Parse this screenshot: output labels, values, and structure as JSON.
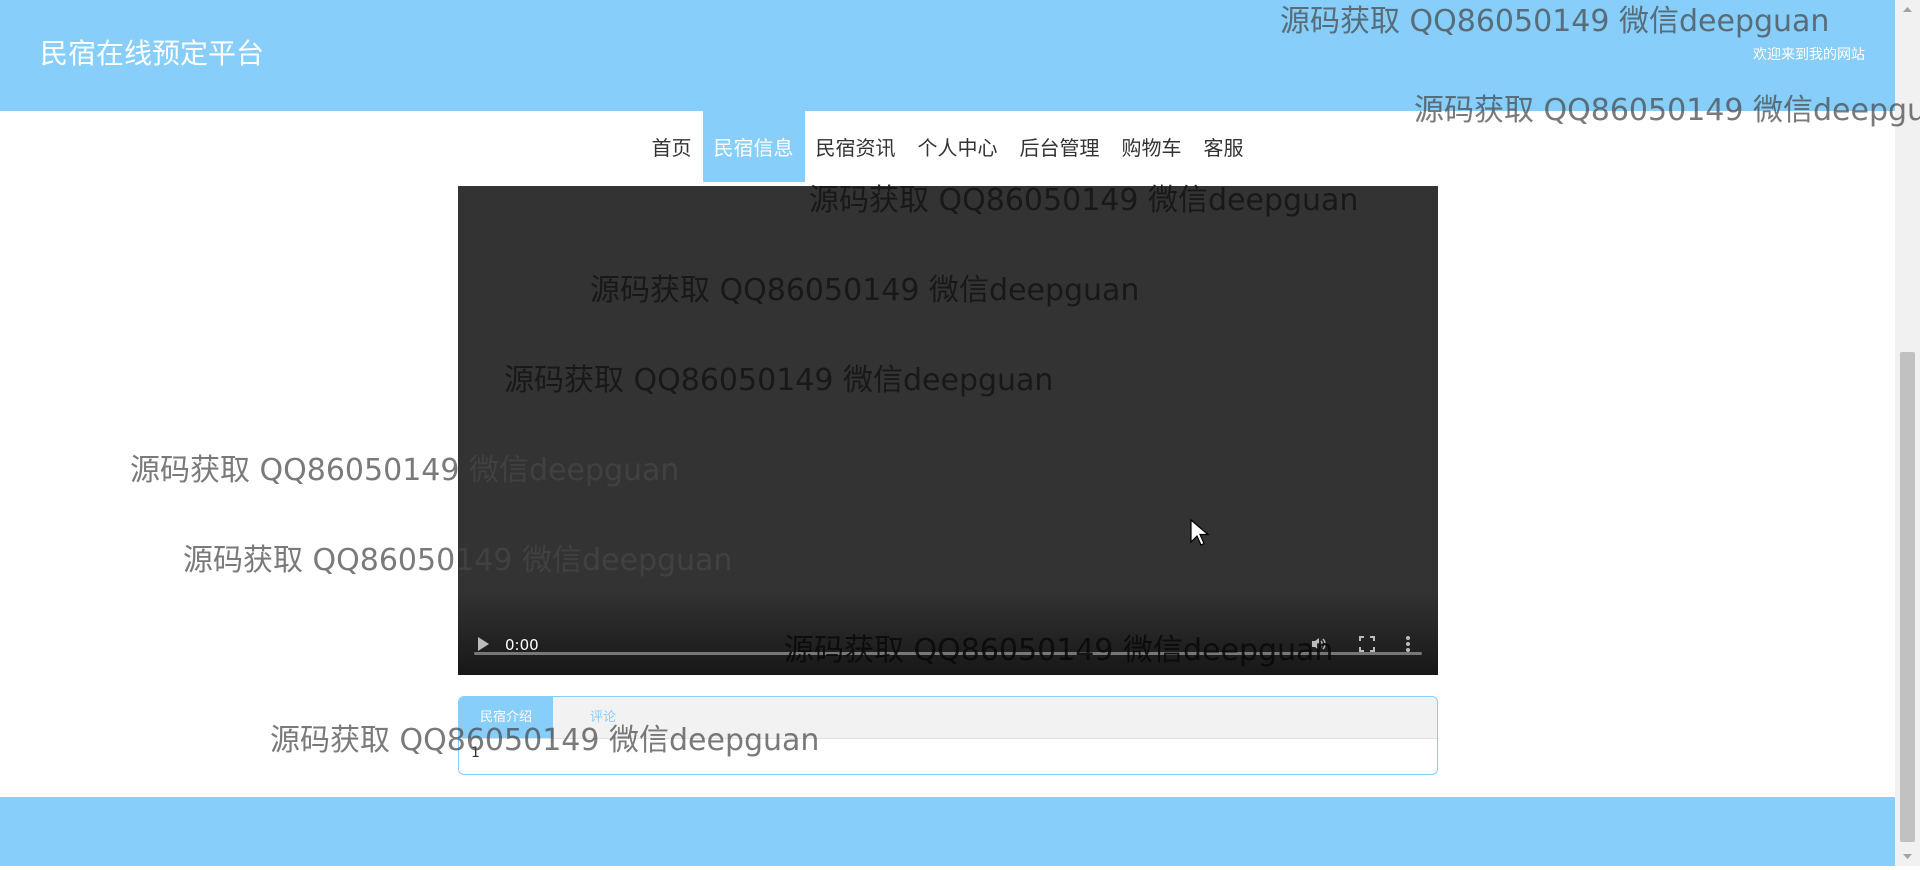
{
  "header": {
    "site_title": "民宿在线预定平台",
    "welcome": "欢迎来到我的网站"
  },
  "nav": {
    "items": [
      {
        "label": "首页"
      },
      {
        "label": "民宿信息",
        "active": true
      },
      {
        "label": "民宿资讯"
      },
      {
        "label": "个人中心"
      },
      {
        "label": "后台管理"
      },
      {
        "label": "购物车"
      },
      {
        "label": "客服"
      }
    ]
  },
  "video": {
    "time": "0:00",
    "progress": 0
  },
  "tabs": {
    "items": [
      {
        "label": "民宿介绍",
        "active": true
      },
      {
        "label": "评论"
      }
    ],
    "content": "1"
  },
  "watermark": {
    "text": "源码获取 QQ86050149 微信deepguan"
  },
  "colors": {
    "accent": "#87cefa",
    "video_bg": "#333333"
  },
  "icons": [
    "play-icon",
    "volume-icon",
    "fullscreen-icon",
    "more-options-icon",
    "cursor-icon"
  ]
}
